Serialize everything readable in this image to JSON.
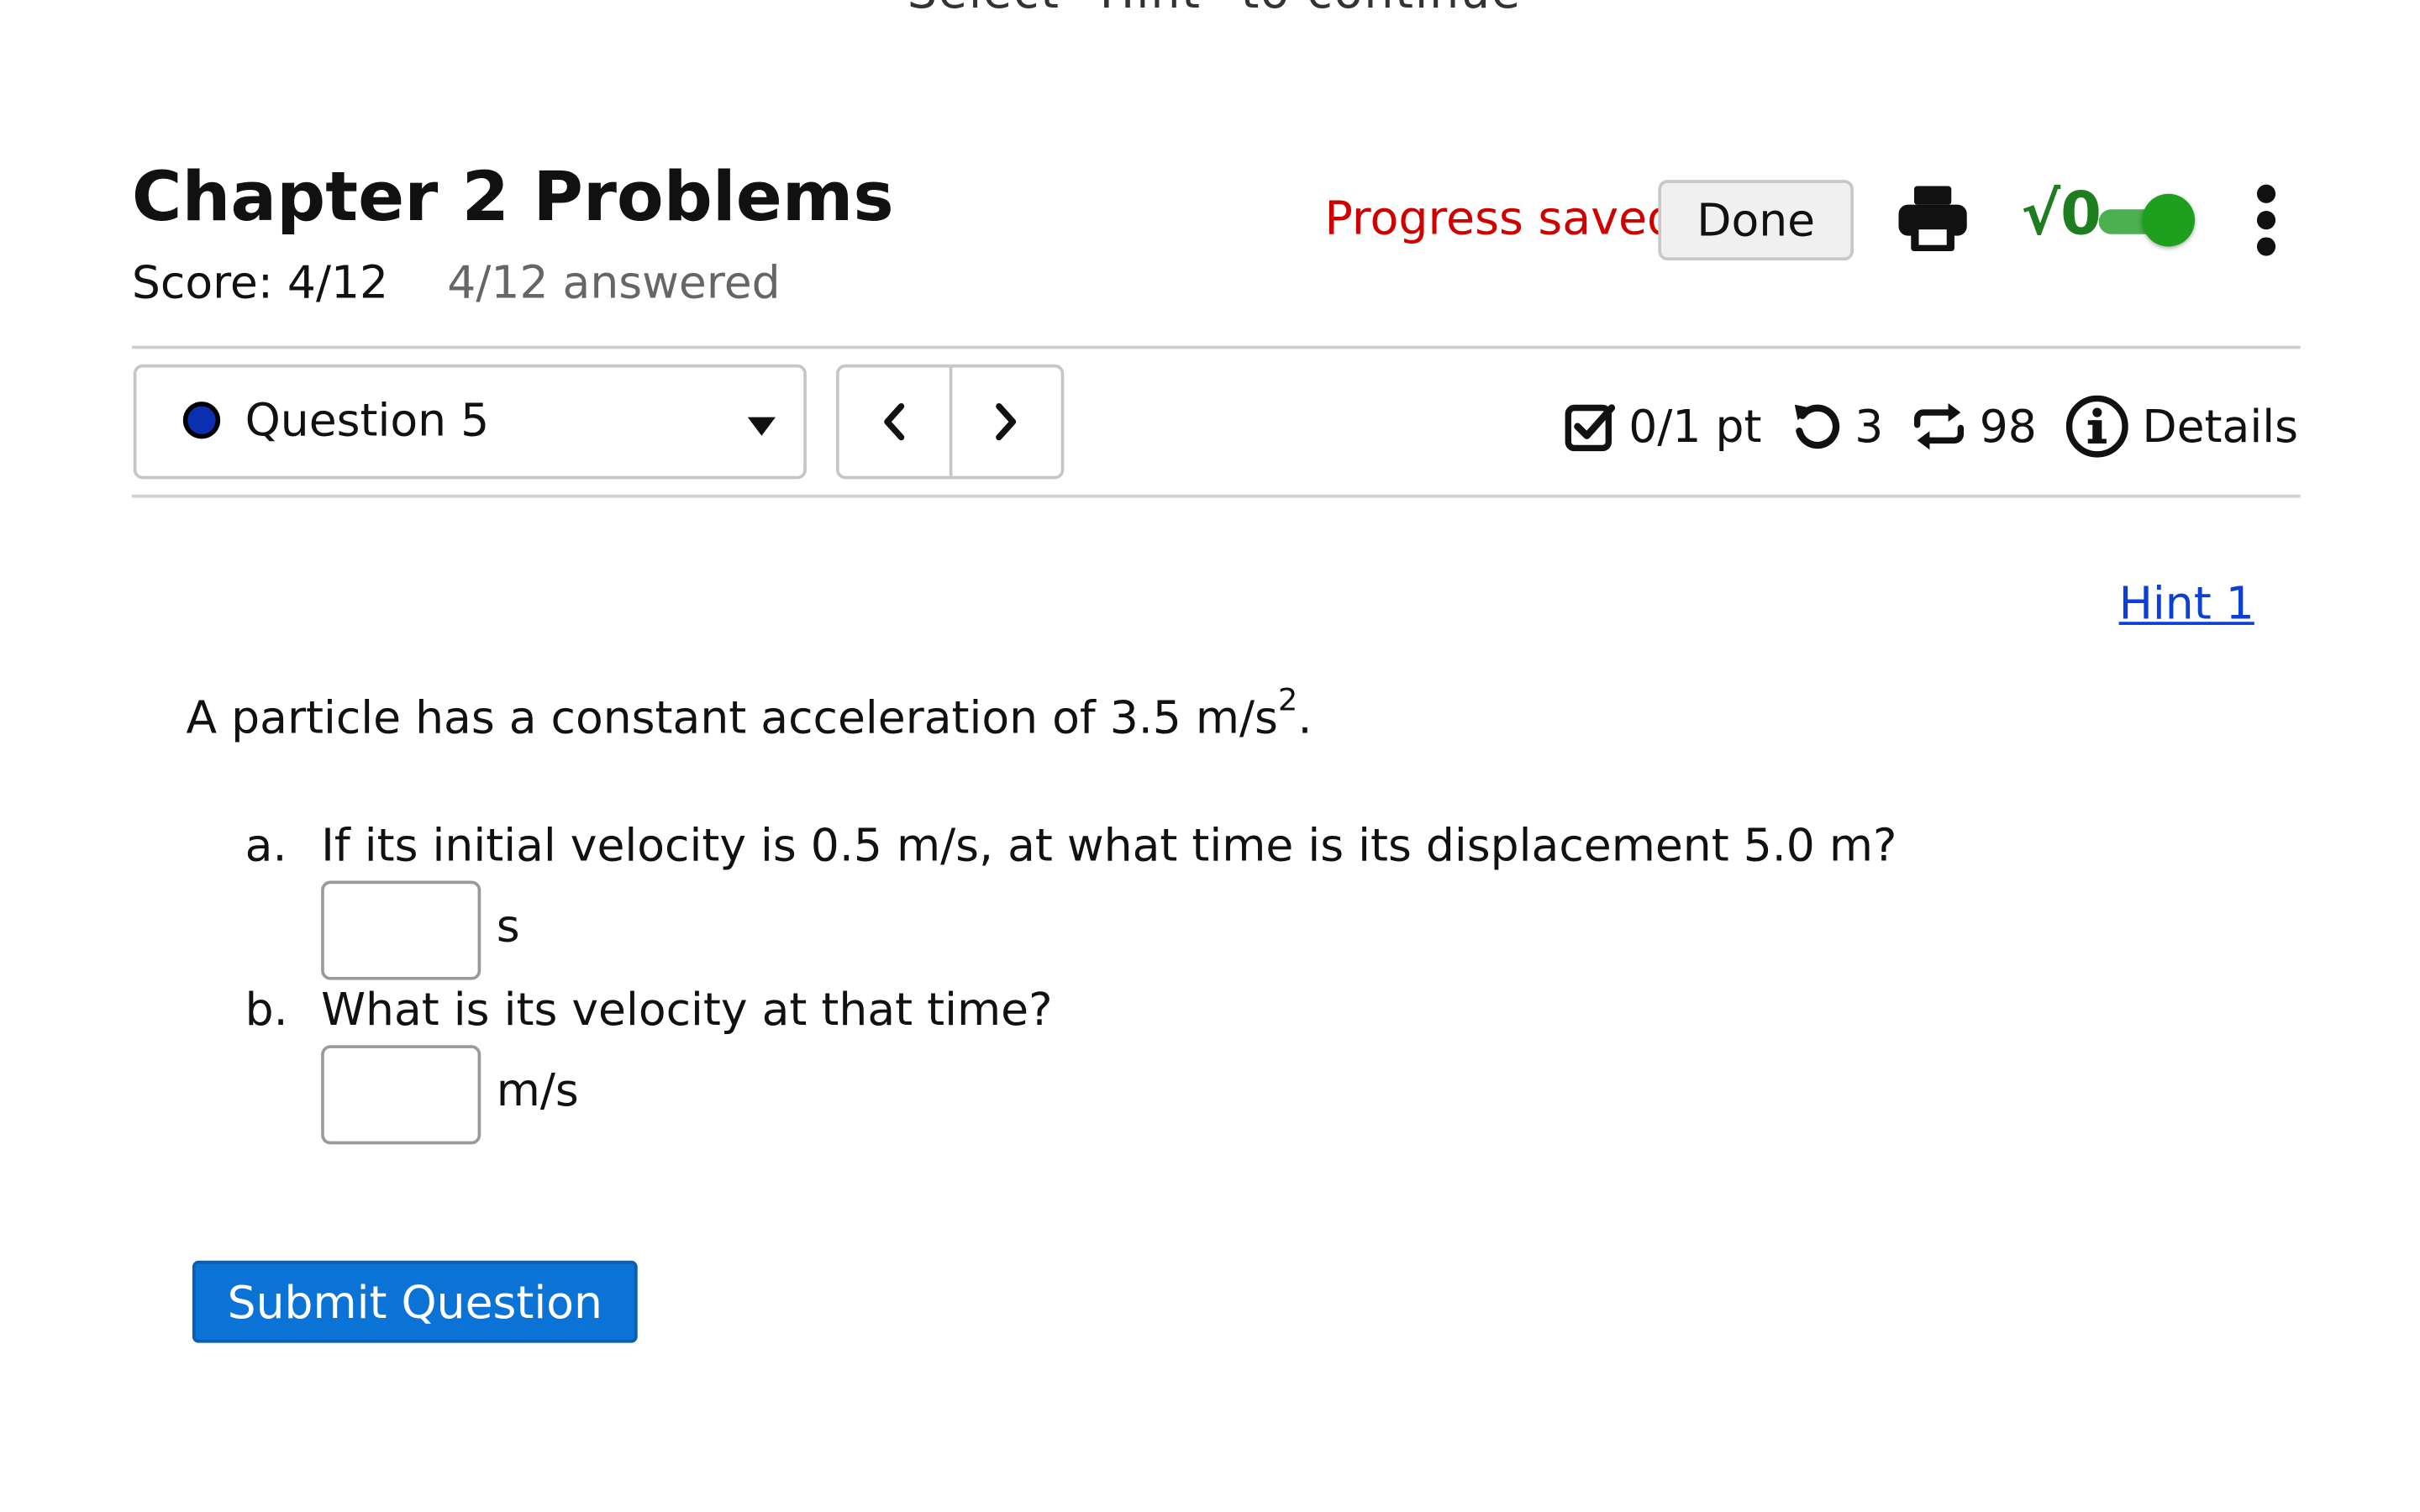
{
  "header": {
    "clipped_banner": "Select \"Hint\" to continue",
    "title": "Chapter 2 Problems",
    "score_label": "Score: 4/12",
    "answered_label": "4/12 answered",
    "progress_status": "Progress saved",
    "done_label": "Done",
    "math_toggle_glyph": "√0",
    "math_toggle_on": true
  },
  "question_nav": {
    "selected_question": "Question 5",
    "status_color": "#0a2fb0"
  },
  "meta": {
    "points": "0/1 pt",
    "retries": "3",
    "attempts": "98",
    "details_label": "Details"
  },
  "hint": {
    "label": "Hint 1"
  },
  "question": {
    "prompt_main": "A particle has a constant acceleration of 3.5 m/s",
    "prompt_sup": "2",
    "prompt_end": ".",
    "parts": [
      {
        "letter": "a.",
        "text": "If its initial velocity is 0.5 m/s, at what time is its displacement 5.0 m?",
        "value": "",
        "unit": "s"
      },
      {
        "letter": "b.",
        "text": "What is its velocity at that time?",
        "value": "",
        "unit": "m/s"
      }
    ]
  },
  "actions": {
    "submit_label": "Submit Question"
  },
  "colors": {
    "accent_blue": "#0b72d6",
    "link_blue": "#0b3fd8",
    "status_red": "#d10000",
    "toggle_green": "#1ea01e"
  }
}
